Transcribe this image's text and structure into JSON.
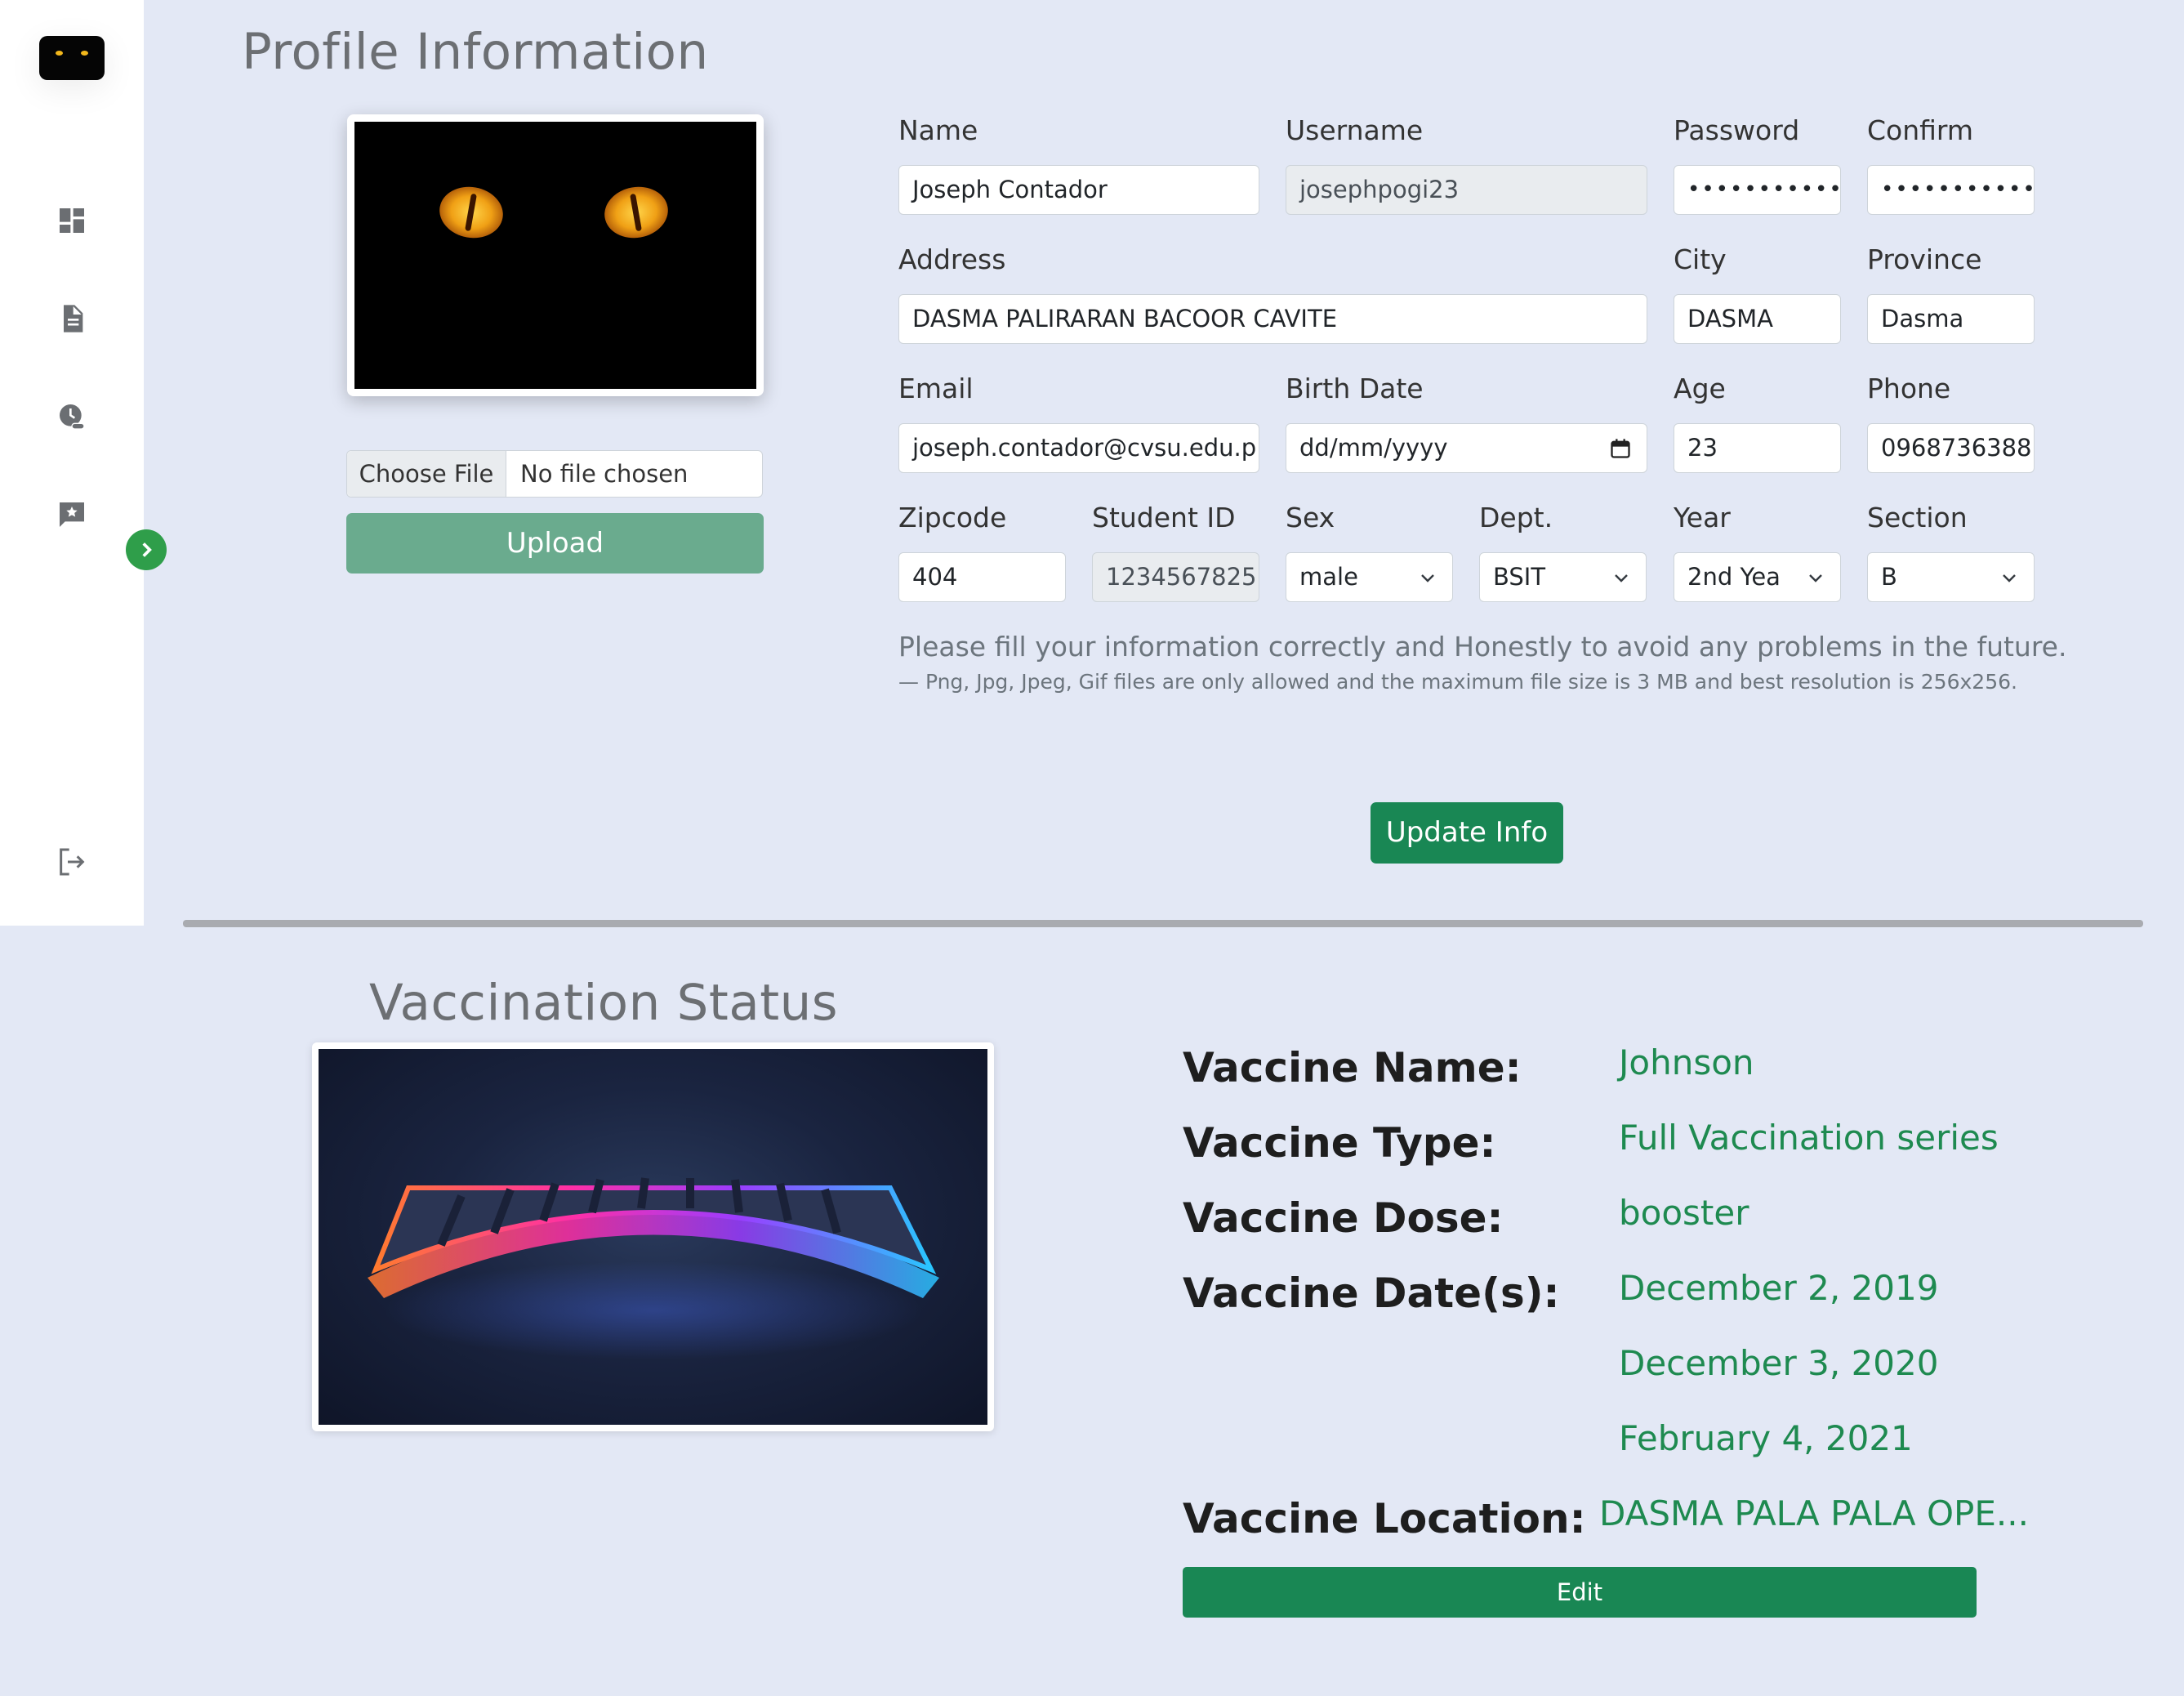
{
  "sidebar": {
    "icons": [
      "dashboard-icon",
      "document-icon",
      "clock-icon",
      "feedback-icon",
      "logout-icon"
    ]
  },
  "profile": {
    "title": "Profile Information",
    "choose_file": "Choose File",
    "no_file": "No file chosen",
    "upload_label": "Upload",
    "fields": {
      "name": {
        "label": "Name",
        "value": "Joseph Contador"
      },
      "username": {
        "label": "Username",
        "value": "josephpogi23"
      },
      "password": {
        "label": "Password",
        "value": "•••••••••••••"
      },
      "confirm": {
        "label": "Confirm",
        "value": "•••••••••••••"
      },
      "address": {
        "label": "Address",
        "value": "DASMA PALIRARAN BACOOR CAVITE"
      },
      "city": {
        "label": "City",
        "value": "DASMA"
      },
      "province": {
        "label": "Province",
        "value": "Dasma"
      },
      "email": {
        "label": "Email",
        "value": "joseph.contador@cvsu.edu.p"
      },
      "birth_date": {
        "label": "Birth Date",
        "value": "dd/mm/yyyy"
      },
      "age": {
        "label": "Age",
        "value": "23"
      },
      "phone": {
        "label": "Phone",
        "value": "0968736388"
      },
      "zipcode": {
        "label": "Zipcode",
        "value": "404"
      },
      "student_id": {
        "label": "Student ID",
        "value": "1234567825"
      },
      "sex": {
        "label": "Sex",
        "value": "male"
      },
      "dept": {
        "label": "Dept.",
        "value": "BSIT"
      },
      "year": {
        "label": "Year",
        "value": "2nd Yea"
      },
      "section": {
        "label": "Section",
        "value": "B"
      }
    },
    "note": "Please fill your information correctly and Honestly to avoid any problems in the future.",
    "file_note": "— Png, Jpg, Jpeg, Gif files are only allowed and the maximum file size is 3 MB and best resolution is 256x256.",
    "update_label": "Update Info"
  },
  "vaccination": {
    "title": "Vaccination Status",
    "name_label": "Vaccine Name:",
    "name_value": "Johnson",
    "type_label": "Vaccine Type:",
    "type_value": "Full Vaccination series",
    "dose_label": "Vaccine Dose:",
    "dose_value": "booster",
    "dates_label": "Vaccine Date(s):",
    "dates": [
      "December 2, 2019",
      "December 3, 2020",
      "February 4, 2021"
    ],
    "location_label": "Vaccine Location:",
    "location_value": "DASMA PALA PALA OPE...",
    "edit_label": "Edit"
  },
  "colors": {
    "accent": "#198754",
    "upload": "#6aab8e",
    "background": "#e3e8f5"
  }
}
